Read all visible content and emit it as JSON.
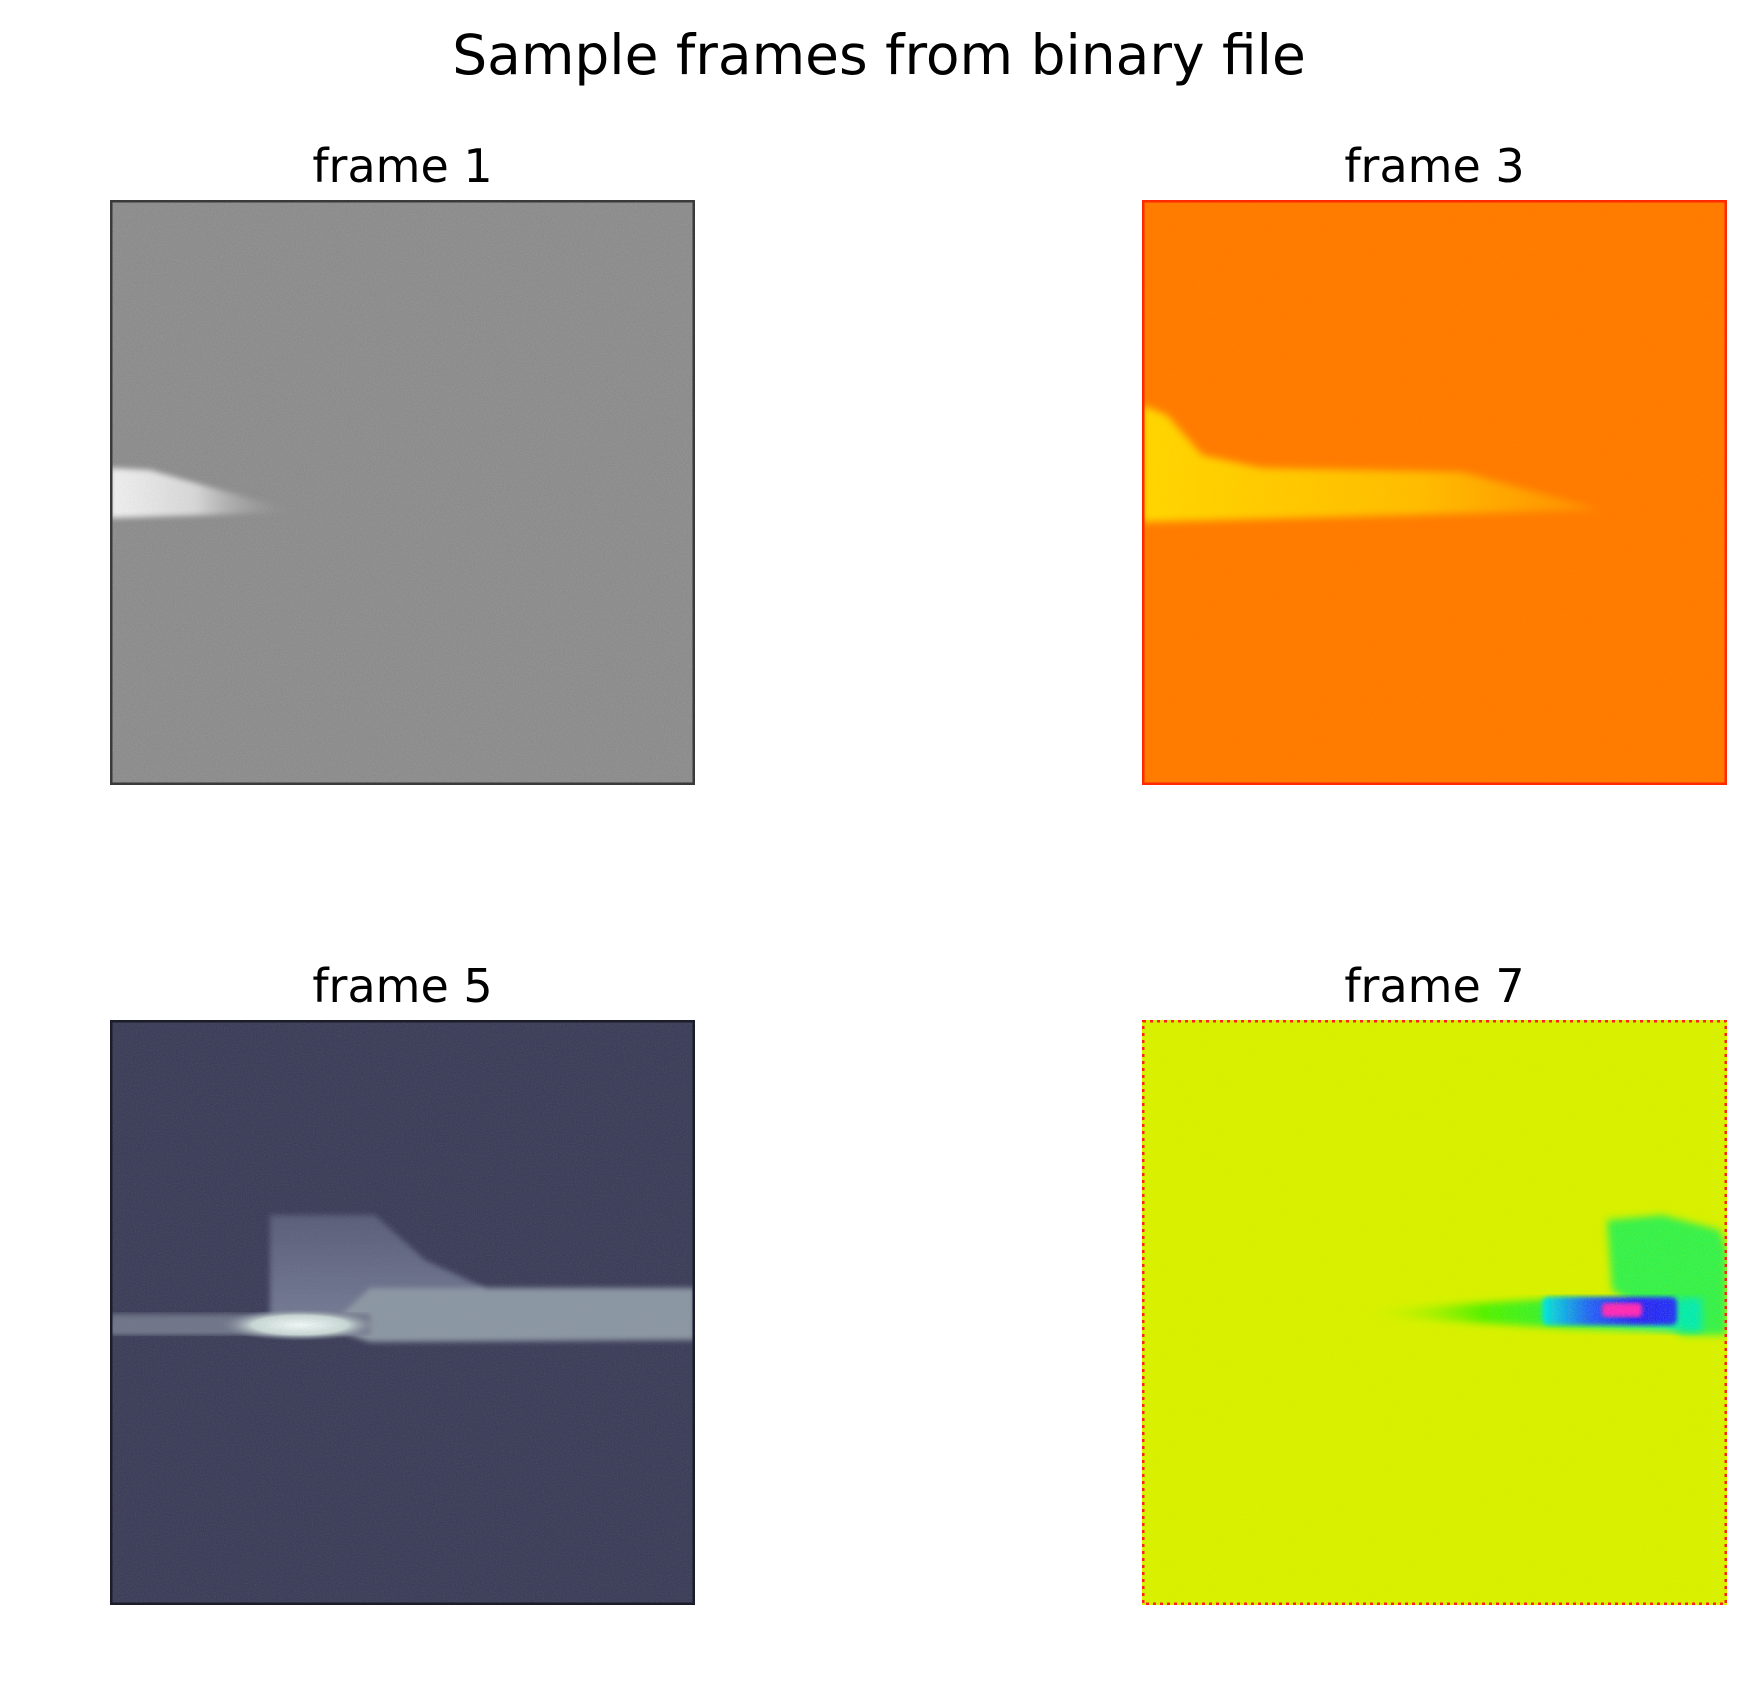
{
  "figure": {
    "title": "Sample frames from binary file"
  },
  "chart_data": [
    {
      "type": "heatmap",
      "title": "frame 1",
      "colormap": "gray",
      "axis": "off",
      "colors": {
        "background": "#8a8a8a",
        "highlight": "#ececec",
        "edge": "#3a3a3a"
      },
      "feature": "bright wedge at left-middle tapering to the right"
    },
    {
      "type": "heatmap",
      "title": "frame 3",
      "colormap": "autumn",
      "axis": "off",
      "colors": {
        "background": "#ff7a00",
        "highlight": "#ffd200",
        "edge": "#ff2a00"
      },
      "feature": "yellow band across middle with raised shoulder at left"
    },
    {
      "type": "heatmap",
      "title": "frame 5",
      "colormap": "bone",
      "axis": "off",
      "colors": {
        "background": "#3c3d57",
        "highlight": "#e8f2f0",
        "band": "#8c97a3",
        "edge": "#1c1d2a"
      },
      "feature": "light horizontal band with hump and bright core"
    },
    {
      "type": "heatmap",
      "title": "frame 7",
      "colormap": "hsv",
      "axis": "off",
      "colors": {
        "background": "#d8f000",
        "green": "#20f020",
        "cyan": "#00e8d8",
        "blue": "#2030ff",
        "magenta": "#ff20c0",
        "edge": "#ff2020"
      },
      "feature": "green plume with blue-magenta core at right-middle"
    }
  ]
}
